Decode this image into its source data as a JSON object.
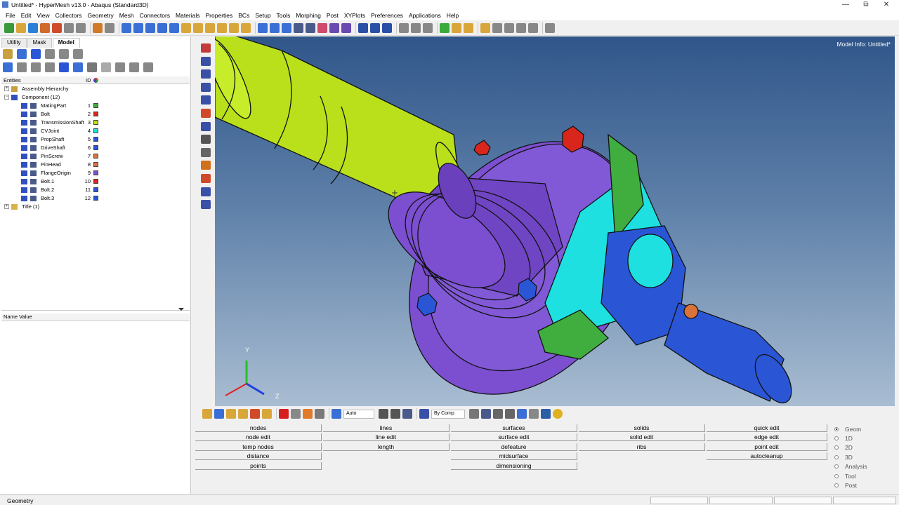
{
  "window": {
    "title": "Untitled* - HyperMesh v13.0 - Abaqus (Standard3D)",
    "minimize": "—",
    "restore": "⧉",
    "close": "✕"
  },
  "menu": [
    "File",
    "Edit",
    "View",
    "Collectors",
    "Geometry",
    "Mesh",
    "Connectors",
    "Materials",
    "Properties",
    "BCs",
    "Setup",
    "Tools",
    "Morphing",
    "Post",
    "XYPlots",
    "Preferences",
    "Applications",
    "Help"
  ],
  "tabs": [
    "Utility",
    "Mask",
    "Model"
  ],
  "tree_header": {
    "entities": "Entities",
    "id": "ID"
  },
  "tree": {
    "assembly": "Assembly Hierarchy",
    "component": "Component (12)",
    "title": "Title (1)",
    "items": [
      {
        "name": "MatingPart",
        "id": "1",
        "color": "#3fae3f"
      },
      {
        "name": "Bolt",
        "id": "2",
        "color": "#d9261c"
      },
      {
        "name": "TransmissionShaft",
        "id": "3",
        "color": "#b9e01a"
      },
      {
        "name": "CVJoint",
        "id": "4",
        "color": "#1ee0e0"
      },
      {
        "name": "PropShaft",
        "id": "5",
        "color": "#2a56d6"
      },
      {
        "name": "DriveShaft",
        "id": "6",
        "color": "#2a56d6"
      },
      {
        "name": "PinScrew",
        "id": "7",
        "color": "#d9733a"
      },
      {
        "name": "PinHead",
        "id": "8",
        "color": "#d9733a"
      },
      {
        "name": "FlangeOrigin",
        "id": "9",
        "color": "#7b4fd0"
      },
      {
        "name": "Bolt.1",
        "id": "10",
        "color": "#d9261c"
      },
      {
        "name": "Bolt.2",
        "id": "11",
        "color": "#2a56d6"
      },
      {
        "name": "Bolt.3",
        "id": "12",
        "color": "#2a56d6"
      }
    ]
  },
  "name_value_header": "Name Value",
  "viewport": {
    "model_info": "Model Info: Untitled*",
    "axis_y": "Y",
    "axis_z": "Z"
  },
  "bottom_toolbar": {
    "auto_select": "Auto",
    "color_mode": "By Comp"
  },
  "menu_panel": {
    "col1": [
      "nodes",
      "node edit",
      "temp nodes",
      "distance",
      "points"
    ],
    "col2": [
      "lines",
      "line edit",
      "length"
    ],
    "col3": [
      "surfaces",
      "surface edit",
      "defeature",
      "midsurface",
      "dimensioning"
    ],
    "col4": [
      "solids",
      "solid edit",
      "ribs"
    ],
    "col5": [
      "quick edit",
      "edge edit",
      "point edit",
      "autocleanup"
    ]
  },
  "modes": [
    {
      "label": "Geom",
      "selected": true
    },
    {
      "label": "1D",
      "selected": false
    },
    {
      "label": "2D",
      "selected": false
    },
    {
      "label": "3D",
      "selected": false
    },
    {
      "label": "Analysis",
      "selected": false
    },
    {
      "label": "Tool",
      "selected": false
    },
    {
      "label": "Post",
      "selected": false
    }
  ],
  "status": "Geometry"
}
